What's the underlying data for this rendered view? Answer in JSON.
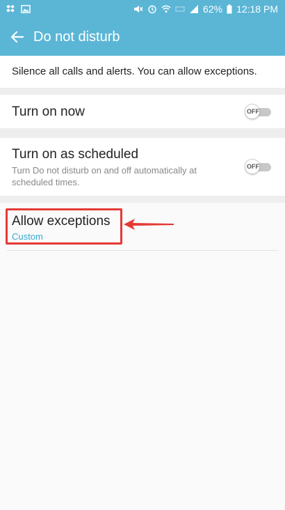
{
  "status_bar": {
    "left_icons": [
      "dropbox-icon",
      "image-icon"
    ],
    "right_icons": [
      "mute-icon",
      "alarm-icon",
      "wifi-icon",
      "hd-icon",
      "signal-icon"
    ],
    "battery": "62%",
    "time": "12:18 PM"
  },
  "header": {
    "title": "Do not disturb",
    "back_icon": "arrow-back-icon"
  },
  "description": "Silence all calls and alerts. You can allow exceptions.",
  "settings": {
    "turn_on_now": {
      "title": "Turn on now",
      "toggle_label": "OFF",
      "toggle_on": false
    },
    "turn_on_scheduled": {
      "title": "Turn on as scheduled",
      "subtitle": "Turn Do not disturb on and off automatically at scheduled times.",
      "toggle_label": "OFF",
      "toggle_on": false
    },
    "allow_exceptions": {
      "title": "Allow exceptions",
      "value": "Custom"
    }
  },
  "colors": {
    "header_bg": "#5bb6d6",
    "accent_text": "#3aa7cf",
    "annotation": "#e53935"
  }
}
